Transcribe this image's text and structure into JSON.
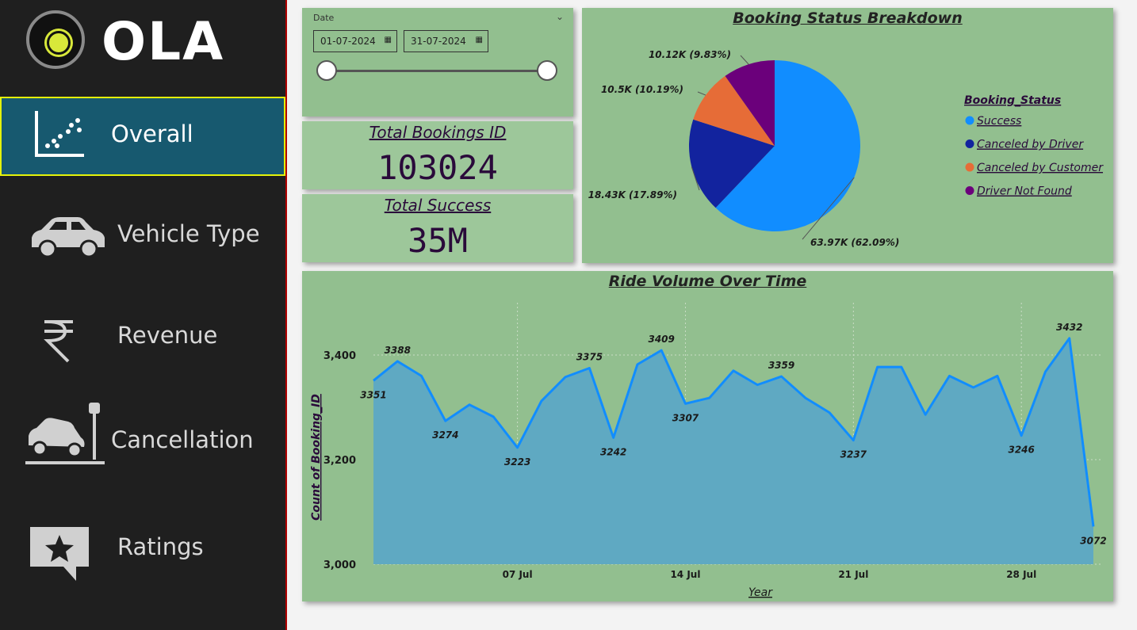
{
  "brand": {
    "name": "OLA"
  },
  "nav": {
    "items": [
      {
        "label": "Overall",
        "icon": "scatter-chart-icon",
        "active": true
      },
      {
        "label": "Vehicle Type",
        "icon": "car-icon",
        "active": false
      },
      {
        "label": "Revenue",
        "icon": "rupee-icon",
        "active": false
      },
      {
        "label": "Cancellation",
        "icon": "car-crash-icon",
        "active": false
      },
      {
        "label": "Ratings",
        "icon": "star-comment-icon",
        "active": false
      }
    ]
  },
  "date_filter": {
    "label": "Date",
    "start": "01-07-2024",
    "end": "31-07-2024"
  },
  "kpis": {
    "total_bookings": {
      "title": "Total Bookings ID",
      "value": "103024"
    },
    "total_success": {
      "title": "Total Success",
      "value": "35M"
    }
  },
  "colors": {
    "panel": "#92bf8f",
    "sidebar": "#1f1f1f",
    "active_nav": "#17596f",
    "active_border": "#e4f20a",
    "success": "#118dff",
    "canceled_driver": "#12239e",
    "canceled_customer": "#e66c37",
    "driver_not_found": "#6b007b"
  },
  "chart_data": [
    {
      "type": "pie",
      "title": "Booking Status Breakdown",
      "legend_title": "Booking_Status",
      "legend_position": "right",
      "slices": [
        {
          "name": "Success",
          "value": 63970,
          "label": "63.97K (62.09%)",
          "color": "#118dff"
        },
        {
          "name": "Canceled by Driver",
          "value": 18430,
          "label": "18.43K (17.89%)",
          "color": "#12239e"
        },
        {
          "name": "Canceled by Customer",
          "value": 10500,
          "label": "10.5K (10.19%)",
          "color": "#e66c37"
        },
        {
          "name": "Driver Not Found",
          "value": 10120,
          "label": "10.12K (9.83%)",
          "color": "#6b007b"
        }
      ]
    },
    {
      "type": "area",
      "title": "Ride Volume Over Time",
      "xlabel": "Year",
      "ylabel": "Count of Booking_ID",
      "ylim": [
        3000,
        3500
      ],
      "yticks": [
        3000,
        3200,
        3400
      ],
      "ytick_labels": [
        "3,000",
        "3,200",
        "3,400"
      ],
      "xticks": [
        {
          "day": 7,
          "label": "07 Jul"
        },
        {
          "day": 14,
          "label": "14 Jul"
        },
        {
          "day": 21,
          "label": "21 Jul"
        },
        {
          "day": 28,
          "label": "28 Jul"
        }
      ],
      "x": [
        1,
        2,
        3,
        4,
        5,
        6,
        7,
        8,
        9,
        10,
        11,
        12,
        13,
        14,
        15,
        16,
        17,
        18,
        19,
        20,
        21,
        22,
        23,
        24,
        25,
        26,
        27,
        28,
        29,
        30,
        31
      ],
      "values": [
        3351,
        3388,
        3360,
        3274,
        3305,
        3282,
        3223,
        3312,
        3358,
        3375,
        3242,
        3382,
        3409,
        3307,
        3318,
        3370,
        3343,
        3359,
        3318,
        3290,
        3237,
        3377,
        3377,
        3286,
        3360,
        3338,
        3360,
        3246,
        3368,
        3432,
        3072
      ],
      "data_labels": [
        {
          "index": 0,
          "text": "3351"
        },
        {
          "index": 1,
          "text": "3388"
        },
        {
          "index": 3,
          "text": "3274"
        },
        {
          "index": 6,
          "text": "3223"
        },
        {
          "index": 9,
          "text": "3375"
        },
        {
          "index": 10,
          "text": "3242"
        },
        {
          "index": 12,
          "text": "3409"
        },
        {
          "index": 13,
          "text": "3307"
        },
        {
          "index": 17,
          "text": "3359"
        },
        {
          "index": 20,
          "text": "3237"
        },
        {
          "index": 27,
          "text": "3246"
        },
        {
          "index": 29,
          "text": "3432"
        },
        {
          "index": 30,
          "text": "3072"
        }
      ],
      "color": "#118dff",
      "fill_color": "#5fa9c2",
      "grid": true
    }
  ]
}
